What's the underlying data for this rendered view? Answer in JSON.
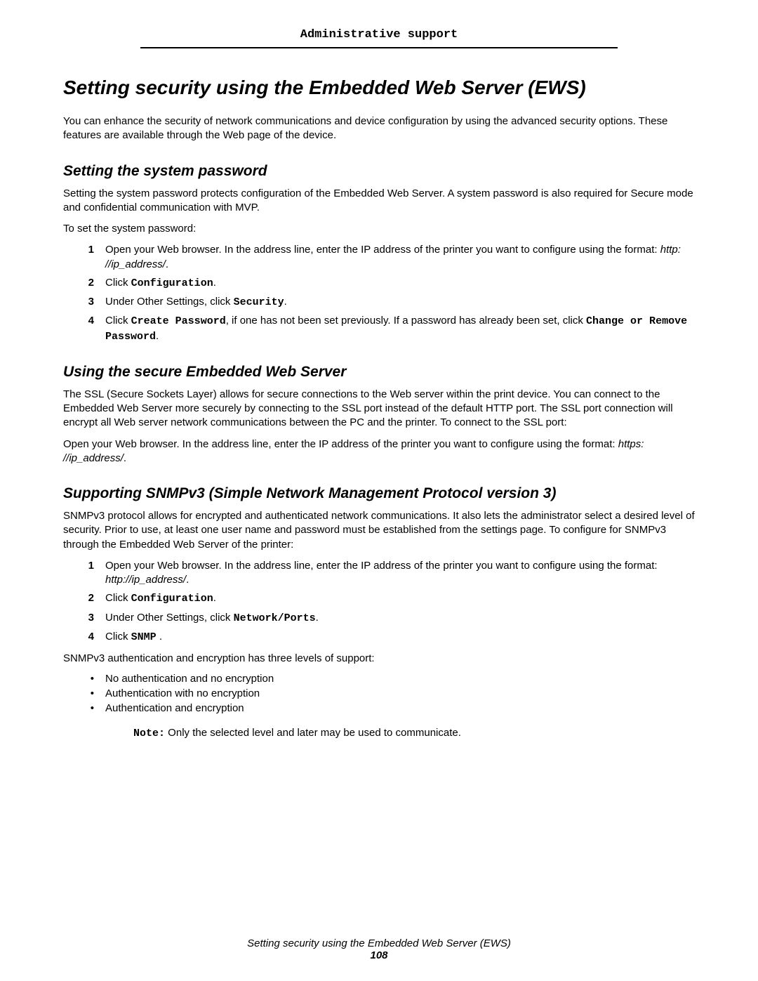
{
  "header": "Administrative support",
  "h1": "Setting security using the Embedded Web Server (EWS)",
  "intro": "You can enhance the security of network communications and device configuration by using the advanced security options. These features are available through the Web page of the device.",
  "s1": {
    "h": "Setting the system password",
    "p1": "Setting the system password protects configuration of the Embedded Web Server. A system password is also required for Secure mode and confidential communication with MVP.",
    "p2": "To set the system password:",
    "steps": {
      "n1": "1",
      "t1a": "Open your Web browser. In the address line, enter the IP address of the printer you want to configure using the format: ",
      "t1b": "http: //ip_address/",
      "t1c": ".",
      "n2": "2",
      "t2a": "Click ",
      "t2b": "Configuration",
      "t2c": ".",
      "n3": "3",
      "t3a": "Under Other Settings, click ",
      "t3b": "Security",
      "t3c": ".",
      "n4": "4",
      "t4a": "Click ",
      "t4b": "Create Password",
      "t4c": ", if one has not been set previously. If a password has already been set, click ",
      "t4d": "Change or Remove Password",
      "t4e": "."
    }
  },
  "s2": {
    "h": "Using the secure Embedded Web Server",
    "p1": "The SSL (Secure Sockets Layer) allows for secure connections to the Web server within the print device. You can connect to the Embedded Web Server more securely by connecting to the SSL port instead of the default HTTP port. The SSL port connection will encrypt all Web server network communications between the PC and the printer. To connect to the SSL port:",
    "p2a": "Open your Web browser. In the address line, enter the IP address of the printer you want to configure using the format: ",
    "p2b": "https: //ip_address/",
    "p2c": "."
  },
  "s3": {
    "h": "Supporting SNMPv3 (Simple Network Management Protocol version 3)",
    "p1": "SNMPv3 protocol allows for encrypted and authenticated network communications. It also lets the administrator select a desired level of security. Prior to use, at least one user name and password must be established from the settings page. To configure for SNMPv3 through the Embedded Web Server of the printer:",
    "steps": {
      "n1": "1",
      "t1a": "Open your Web browser. In the address line, enter the IP address of the printer you want to configure using the format: ",
      "t1b": "http://ip_address/",
      "t1c": ".",
      "n2": "2",
      "t2a": "Click ",
      "t2b": "Configuration",
      "t2c": ".",
      "n3": "3",
      "t3a": "Under Other Settings, click ",
      "t3b": "Network/Ports",
      "t3c": ".",
      "n4": "4",
      "t4a": "Click ",
      "t4b": "SNMP",
      "t4c": " ."
    },
    "p2": "SNMPv3 authentication and encryption has three levels of support:",
    "b1": "No authentication and no encryption",
    "b2": "Authentication with no encryption",
    "b3": "Authentication and encryption",
    "noteLabel": "Note:",
    "noteText": " Only the selected level and later may be used to communicate."
  },
  "footer": {
    "title": "Setting security using the Embedded Web Server (EWS)",
    "page": "108"
  }
}
